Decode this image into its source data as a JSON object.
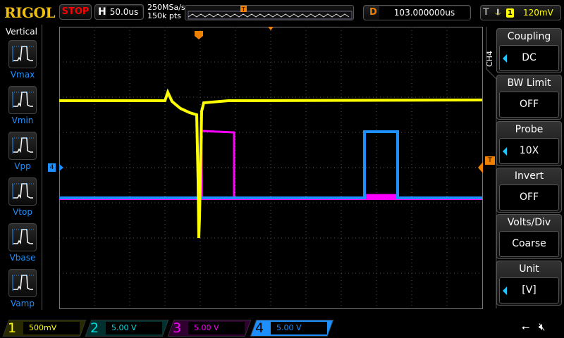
{
  "header": {
    "brand": "RIGOL",
    "run_state": "STOP",
    "h_label": "H",
    "timebase": "50.0us",
    "sample_rate": "250MSa/s",
    "memory_depth": "150k pts",
    "trigger_marker": "T",
    "d_label": "D",
    "delay": "103.000000us",
    "t_label": "T",
    "trigger_edge": "falling",
    "trigger_source": "1",
    "trigger_level": "120mV"
  },
  "left_panel": {
    "title": "Vertical",
    "items": [
      {
        "label": "Vmax"
      },
      {
        "label": "Vmin"
      },
      {
        "label": "Vpp"
      },
      {
        "label": "Vtop"
      },
      {
        "label": "Vbase"
      },
      {
        "label": "Vamp"
      }
    ]
  },
  "right_panel": {
    "channel": "CH4",
    "menu": [
      {
        "title": "Coupling",
        "value": "DC",
        "arrow": true
      },
      {
        "title": "BW Limit",
        "value": "OFF",
        "arrow": false
      },
      {
        "title": "Probe",
        "value": "10X",
        "arrow": true
      },
      {
        "title": "Invert",
        "value": "OFF",
        "arrow": false
      },
      {
        "title": "Volts/Div",
        "value": "Coarse",
        "arrow": false
      },
      {
        "title": "Unit",
        "value": "[V]",
        "arrow": true
      }
    ]
  },
  "channels": [
    {
      "num": "1",
      "scale": "500mV",
      "color": "#ffff00"
    },
    {
      "num": "2",
      "scale": "5.00 V",
      "color": "#00e0e0"
    },
    {
      "num": "3",
      "scale": "5.00 V",
      "color": "#ff00ff"
    },
    {
      "num": "4",
      "scale": "5.00 V",
      "color": "#1e8fff"
    }
  ],
  "markers": {
    "ch4_marker": "4",
    "trigger_level_marker": "T"
  }
}
